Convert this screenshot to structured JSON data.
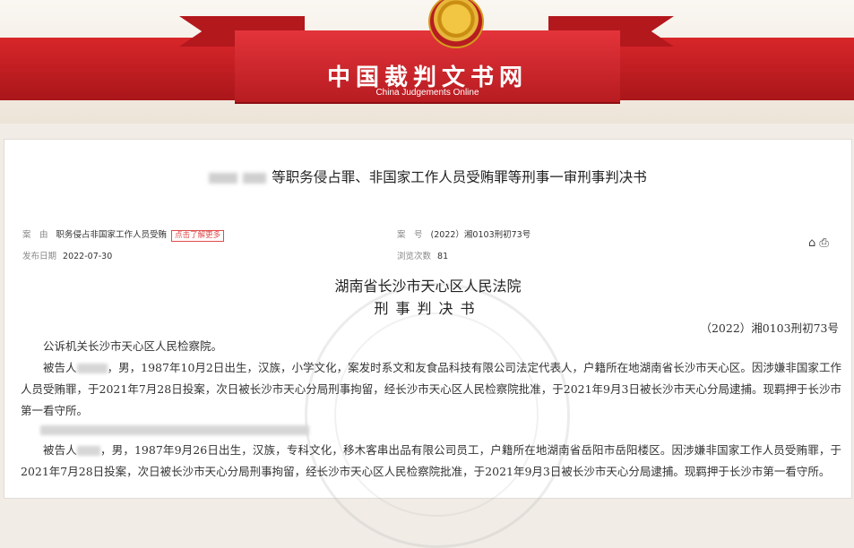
{
  "site": {
    "title": "中国裁判文书网",
    "subtitle": "China Judgements Online"
  },
  "document": {
    "title_suffix": "等职务侵占罪、非国家工作人员受贿罪等刑事一审刑事判决书",
    "meta": {
      "cause_label": "案　由",
      "cause_value": "职务侵占非国家工作人员受贿",
      "more_tag": "点击了解更多",
      "case_no_label": "案　号",
      "case_no_value": "(2022）湘0103刑初73号",
      "pub_date_label": "发布日期",
      "pub_date_value": "2022-07-30",
      "views_label": "浏览次数",
      "views_value": "81"
    },
    "court": "湖南省长沙市天心区人民法院",
    "doc_type": "刑事判决书",
    "case_number": "（2022）湘0103刑初73号",
    "p1": "公诉机关长沙市天心区人民检察院。",
    "p2_a": "被告人",
    "p2_b": "，男，1987年10月2日出生，汉族，小学文化，案发时系文和友食品科技有限公司法定代表人，户籍所在地湖南省长沙市天心区。因涉嫌非国家工作人员受贿罪，于2021年7月28日投案，次日被长沙市天心分局刑事拘留，经长沙市天心区人民检察院批准，于2021年9月3日被长沙市天心分局逮捕。现羁押于长沙市第一看守所。",
    "p3_a": "被告人",
    "p3_b": "，男，1987年9月26日出生，汉族，专科文化，移木客串出品有限公司员工，户籍所在地湖南省岳阳市岳阳楼区。因涉嫌非国家工作人员受贿罪，于2021年7月28日投案，次日被长沙市天心分局刑事拘留，经长沙市天心区人民检察院批准，于2021年9月3日被长沙市天心分局逮捕。现羁押于长沙市第一看守所。"
  },
  "icons": {
    "share": "share-icon",
    "print": "print-icon"
  }
}
